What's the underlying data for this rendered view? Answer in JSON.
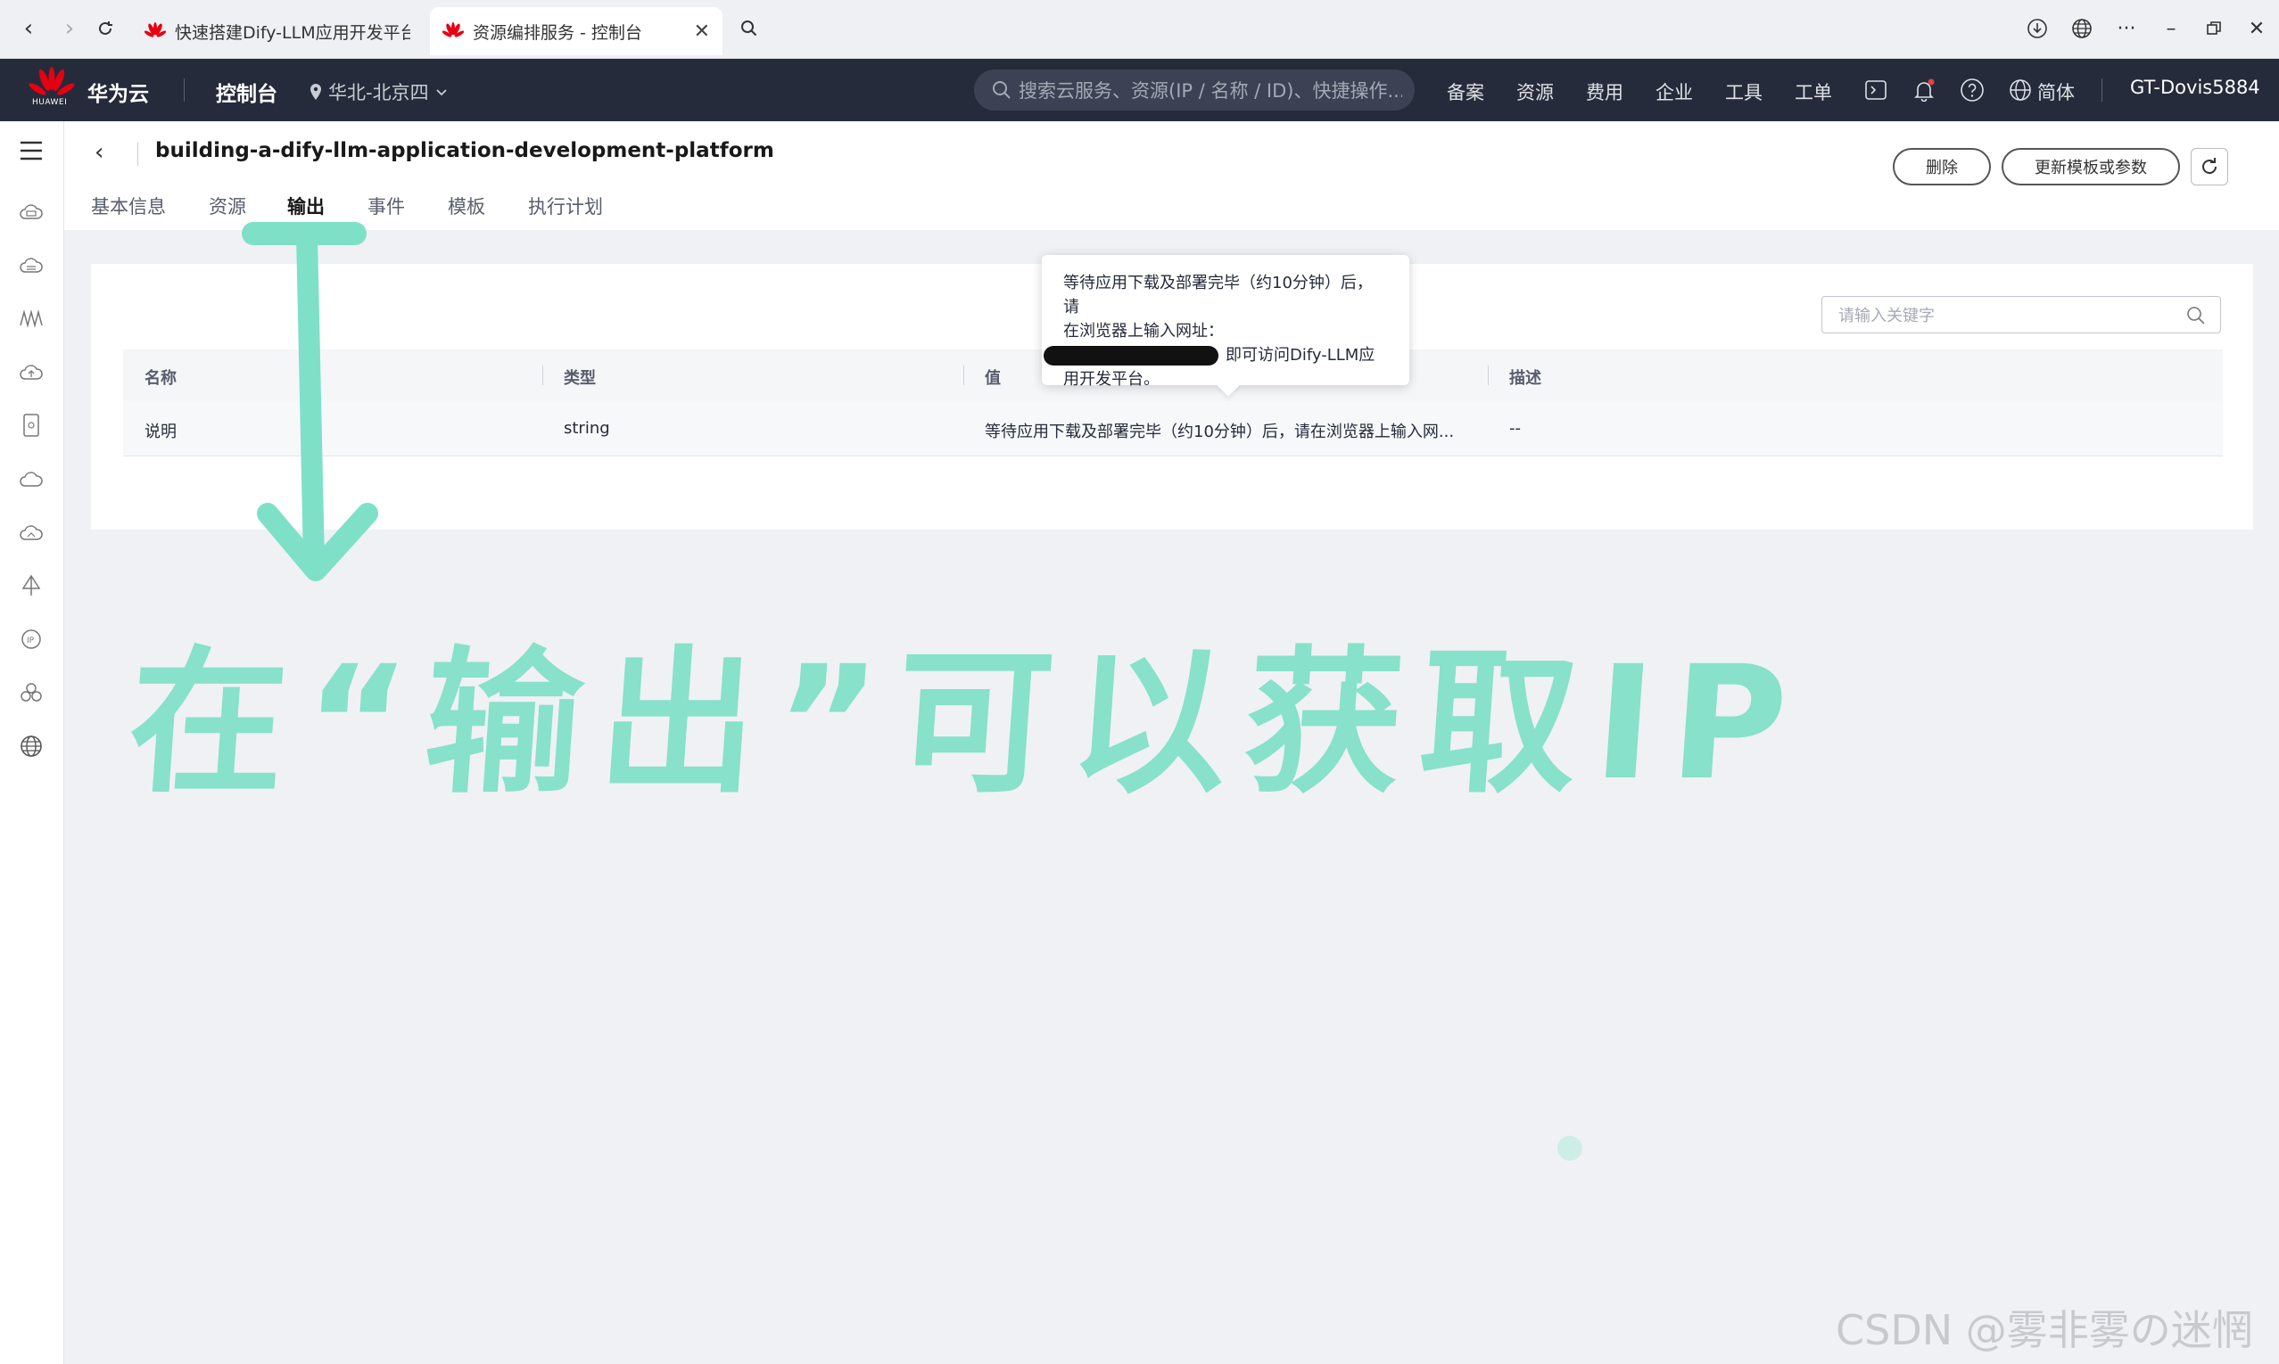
{
  "browser": {
    "tabs": [
      {
        "title": "快速搭建Dify-LLM应用开发平台-"
      },
      {
        "title": "资源编排服务 - 控制台"
      }
    ]
  },
  "header": {
    "logo_text": "HUAWEI",
    "brand": "华为云",
    "console": "控制台",
    "region": "华北-北京四",
    "search_placeholder": "搜索云服务、资源(IP / 名称 / ID)、快捷操作...",
    "links": [
      "备案",
      "资源",
      "费用",
      "企业",
      "工具",
      "工单"
    ],
    "language": "简体",
    "account": "GT-Dovis5884"
  },
  "page": {
    "title": "building-a-dify-llm-application-development-platform",
    "delete_label": "删除",
    "update_label": "更新模板或参数",
    "tabs": [
      "基本信息",
      "资源",
      "输出",
      "事件",
      "模板",
      "执行计划"
    ],
    "active_tab": "输出"
  },
  "outputs": {
    "filter_placeholder": "请输入关键字",
    "columns": [
      "名称",
      "类型",
      "值",
      "描述"
    ],
    "rows": [
      {
        "name": "说明",
        "type": "string",
        "value": "等待应用下载及部署完毕（约10分钟）后，请在浏览器上输入网...",
        "desc": "--"
      }
    ]
  },
  "tooltip": {
    "line1": "等待应用下载及部署完毕（约10分钟）后，请",
    "line2": "在浏览器上输入网址：",
    "line3": "即可访问Dify-LLM应",
    "line4": "用开发平台。"
  },
  "annotation": {
    "text": "在“输出”可以获取IP",
    "color": "#7fe0c8"
  },
  "watermark": "CSDN @雾非雾の迷惘"
}
